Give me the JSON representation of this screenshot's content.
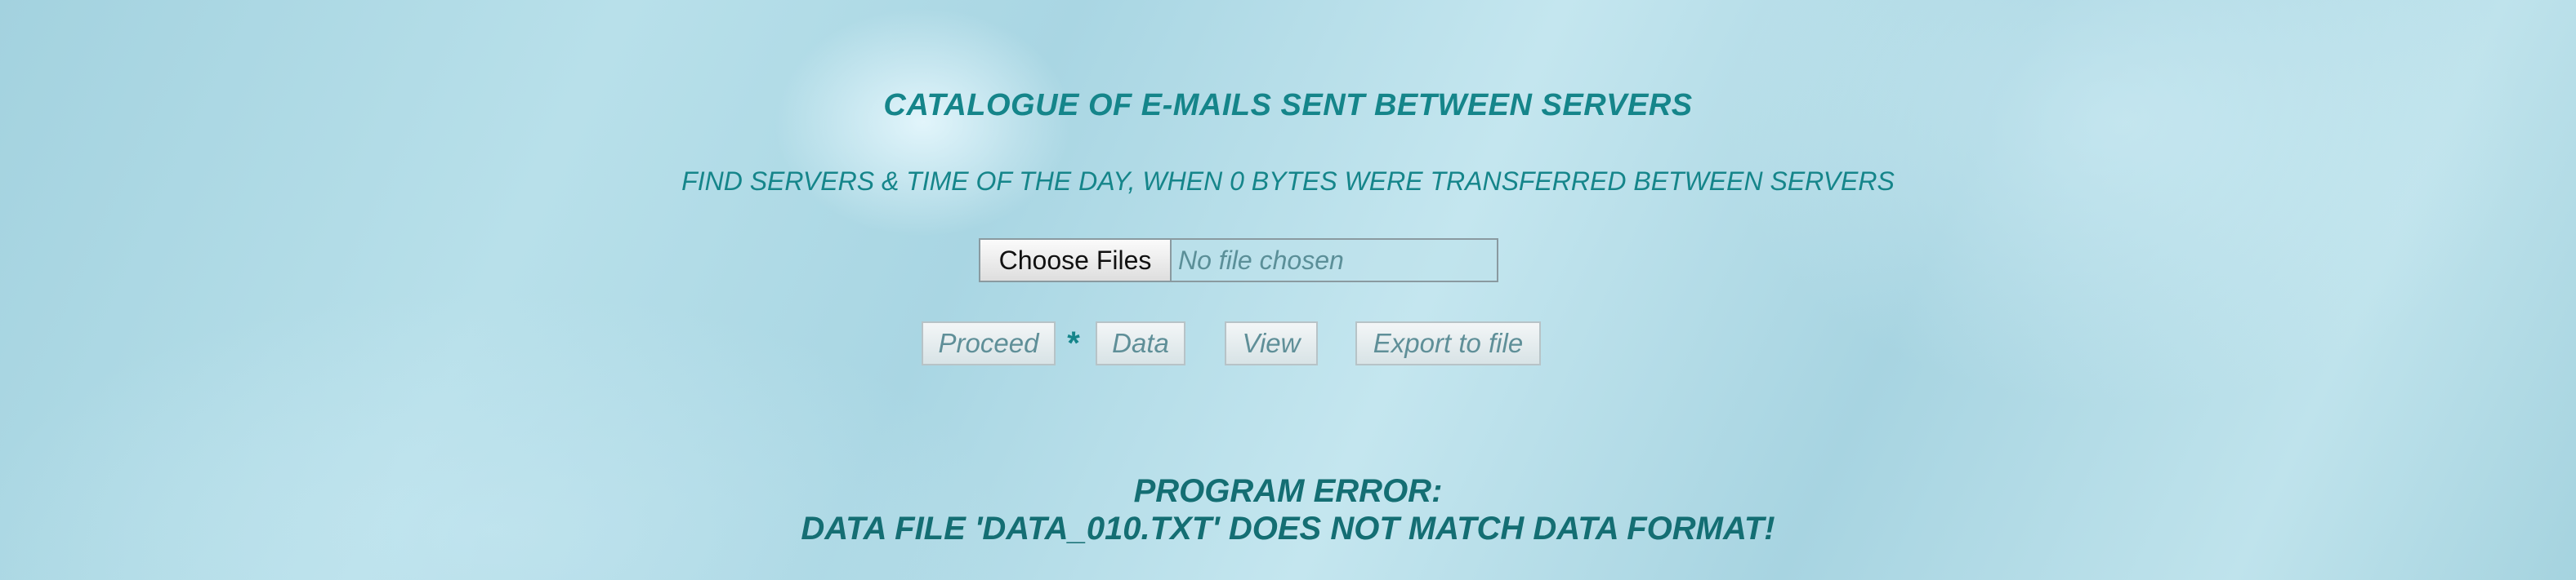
{
  "header": {
    "title": "CATALOGUE OF E-MAILS SENT BETWEEN SERVERS",
    "subtitle": "FIND SERVERS & TIME OF THE DAY, WHEN 0 BYTES WERE TRANSFERRED BETWEEN SERVERS"
  },
  "file_input": {
    "button_label": "Choose Files",
    "status": "No file chosen"
  },
  "actions": {
    "proceed": "Proceed",
    "separator": "*",
    "data": "Data",
    "view": "View",
    "export": "Export to file"
  },
  "error": {
    "line1": "PROGRAM ERROR:",
    "line2": "DATA FILE 'DATA_010.TXT' DOES NOT MATCH DATA FORMAT!"
  },
  "colors": {
    "accent": "#15858a",
    "error": "#146e73",
    "disabled_text": "#5f8f98"
  }
}
